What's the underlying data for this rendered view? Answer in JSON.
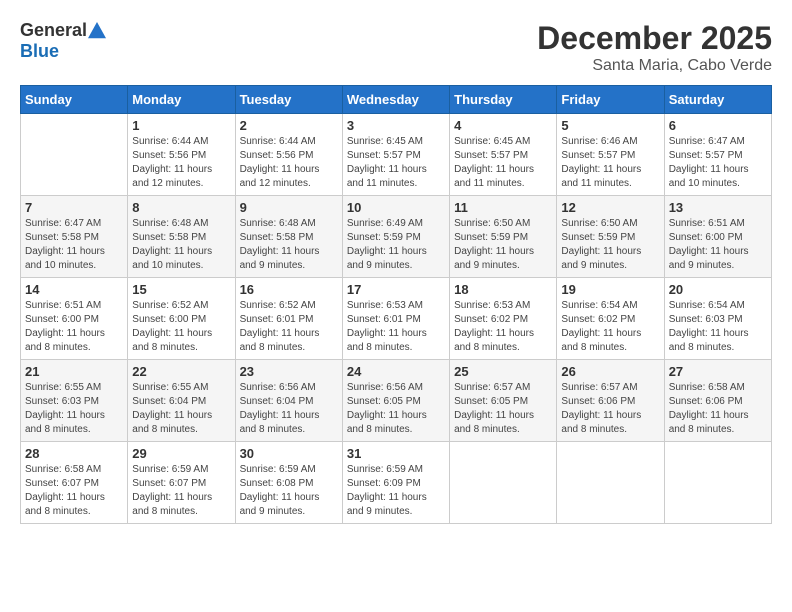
{
  "header": {
    "logo_general": "General",
    "logo_blue": "Blue",
    "month": "December 2025",
    "location": "Santa Maria, Cabo Verde"
  },
  "calendar": {
    "days_of_week": [
      "Sunday",
      "Monday",
      "Tuesday",
      "Wednesday",
      "Thursday",
      "Friday",
      "Saturday"
    ],
    "weeks": [
      [
        {
          "day": "",
          "info": ""
        },
        {
          "day": "1",
          "info": "Sunrise: 6:44 AM\nSunset: 5:56 PM\nDaylight: 11 hours and 12 minutes."
        },
        {
          "day": "2",
          "info": "Sunrise: 6:44 AM\nSunset: 5:56 PM\nDaylight: 11 hours and 12 minutes."
        },
        {
          "day": "3",
          "info": "Sunrise: 6:45 AM\nSunset: 5:57 PM\nDaylight: 11 hours and 11 minutes."
        },
        {
          "day": "4",
          "info": "Sunrise: 6:45 AM\nSunset: 5:57 PM\nDaylight: 11 hours and 11 minutes."
        },
        {
          "day": "5",
          "info": "Sunrise: 6:46 AM\nSunset: 5:57 PM\nDaylight: 11 hours and 11 minutes."
        },
        {
          "day": "6",
          "info": "Sunrise: 6:47 AM\nSunset: 5:57 PM\nDaylight: 11 hours and 10 minutes."
        }
      ],
      [
        {
          "day": "7",
          "info": "Sunrise: 6:47 AM\nSunset: 5:58 PM\nDaylight: 11 hours and 10 minutes."
        },
        {
          "day": "8",
          "info": "Sunrise: 6:48 AM\nSunset: 5:58 PM\nDaylight: 11 hours and 10 minutes."
        },
        {
          "day": "9",
          "info": "Sunrise: 6:48 AM\nSunset: 5:58 PM\nDaylight: 11 hours and 9 minutes."
        },
        {
          "day": "10",
          "info": "Sunrise: 6:49 AM\nSunset: 5:59 PM\nDaylight: 11 hours and 9 minutes."
        },
        {
          "day": "11",
          "info": "Sunrise: 6:50 AM\nSunset: 5:59 PM\nDaylight: 11 hours and 9 minutes."
        },
        {
          "day": "12",
          "info": "Sunrise: 6:50 AM\nSunset: 5:59 PM\nDaylight: 11 hours and 9 minutes."
        },
        {
          "day": "13",
          "info": "Sunrise: 6:51 AM\nSunset: 6:00 PM\nDaylight: 11 hours and 9 minutes."
        }
      ],
      [
        {
          "day": "14",
          "info": "Sunrise: 6:51 AM\nSunset: 6:00 PM\nDaylight: 11 hours and 8 minutes."
        },
        {
          "day": "15",
          "info": "Sunrise: 6:52 AM\nSunset: 6:00 PM\nDaylight: 11 hours and 8 minutes."
        },
        {
          "day": "16",
          "info": "Sunrise: 6:52 AM\nSunset: 6:01 PM\nDaylight: 11 hours and 8 minutes."
        },
        {
          "day": "17",
          "info": "Sunrise: 6:53 AM\nSunset: 6:01 PM\nDaylight: 11 hours and 8 minutes."
        },
        {
          "day": "18",
          "info": "Sunrise: 6:53 AM\nSunset: 6:02 PM\nDaylight: 11 hours and 8 minutes."
        },
        {
          "day": "19",
          "info": "Sunrise: 6:54 AM\nSunset: 6:02 PM\nDaylight: 11 hours and 8 minutes."
        },
        {
          "day": "20",
          "info": "Sunrise: 6:54 AM\nSunset: 6:03 PM\nDaylight: 11 hours and 8 minutes."
        }
      ],
      [
        {
          "day": "21",
          "info": "Sunrise: 6:55 AM\nSunset: 6:03 PM\nDaylight: 11 hours and 8 minutes."
        },
        {
          "day": "22",
          "info": "Sunrise: 6:55 AM\nSunset: 6:04 PM\nDaylight: 11 hours and 8 minutes."
        },
        {
          "day": "23",
          "info": "Sunrise: 6:56 AM\nSunset: 6:04 PM\nDaylight: 11 hours and 8 minutes."
        },
        {
          "day": "24",
          "info": "Sunrise: 6:56 AM\nSunset: 6:05 PM\nDaylight: 11 hours and 8 minutes."
        },
        {
          "day": "25",
          "info": "Sunrise: 6:57 AM\nSunset: 6:05 PM\nDaylight: 11 hours and 8 minutes."
        },
        {
          "day": "26",
          "info": "Sunrise: 6:57 AM\nSunset: 6:06 PM\nDaylight: 11 hours and 8 minutes."
        },
        {
          "day": "27",
          "info": "Sunrise: 6:58 AM\nSunset: 6:06 PM\nDaylight: 11 hours and 8 minutes."
        }
      ],
      [
        {
          "day": "28",
          "info": "Sunrise: 6:58 AM\nSunset: 6:07 PM\nDaylight: 11 hours and 8 minutes."
        },
        {
          "day": "29",
          "info": "Sunrise: 6:59 AM\nSunset: 6:07 PM\nDaylight: 11 hours and 8 minutes."
        },
        {
          "day": "30",
          "info": "Sunrise: 6:59 AM\nSunset: 6:08 PM\nDaylight: 11 hours and 9 minutes."
        },
        {
          "day": "31",
          "info": "Sunrise: 6:59 AM\nSunset: 6:09 PM\nDaylight: 11 hours and 9 minutes."
        },
        {
          "day": "",
          "info": ""
        },
        {
          "day": "",
          "info": ""
        },
        {
          "day": "",
          "info": ""
        }
      ]
    ]
  }
}
